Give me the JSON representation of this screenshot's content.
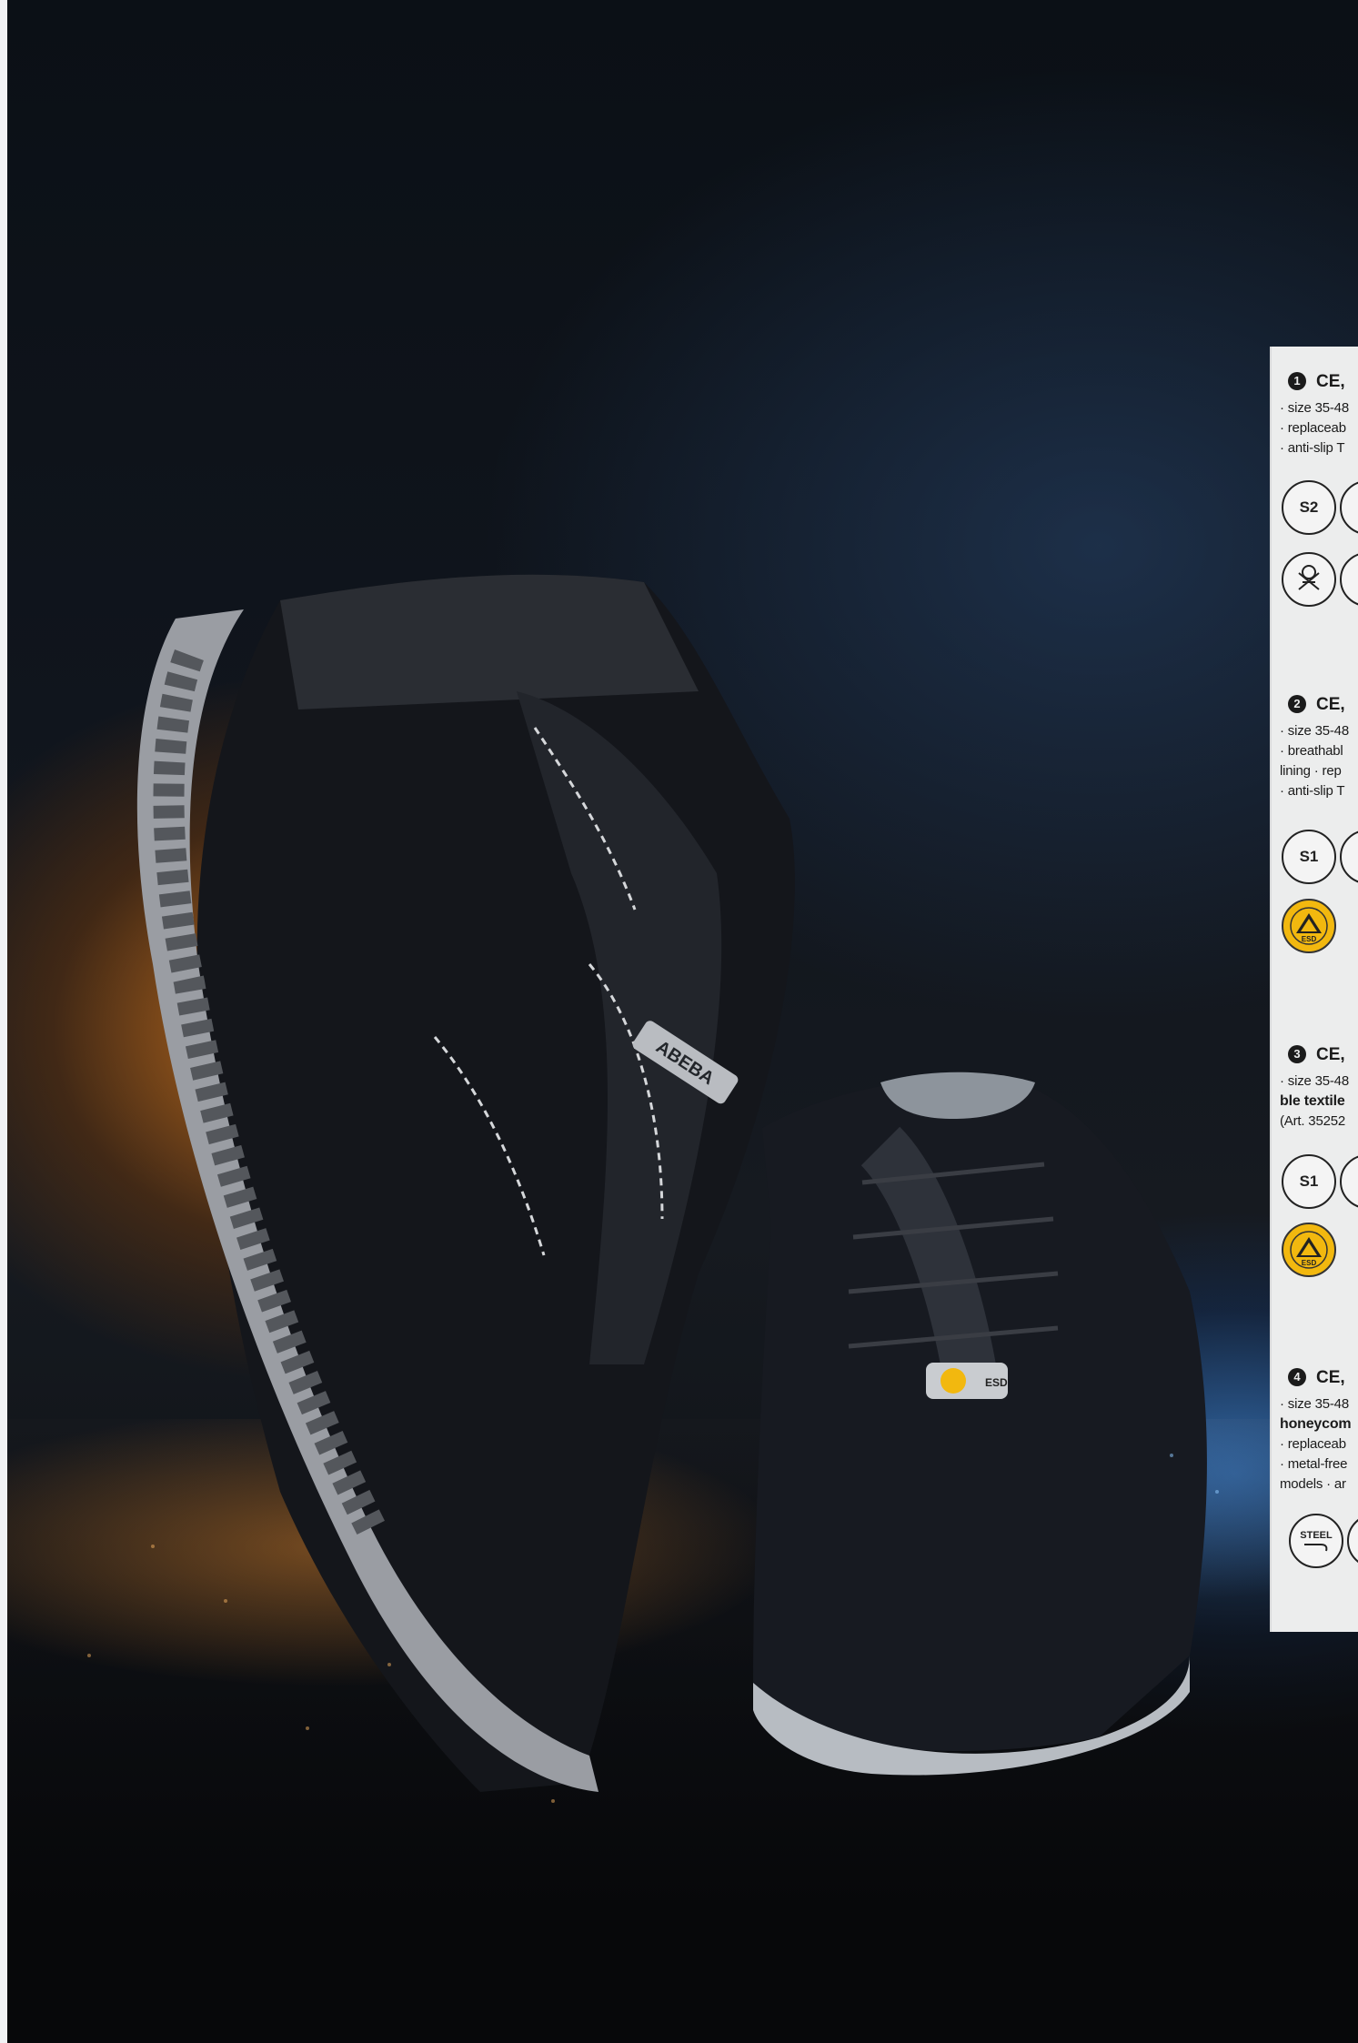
{
  "brand": {
    "logo_text": "ABEBA"
  },
  "heel_badge": "ESD",
  "entries": [
    {
      "number": "1",
      "heading": "CE,",
      "lines": [
        {
          "text": "· size 35-48",
          "bold": false
        },
        {
          "text": "· replaceab",
          "bold": false
        },
        {
          "text": "· anti-slip T",
          "bold": false
        }
      ],
      "badges": [
        "S2",
        "chef-icon"
      ]
    },
    {
      "number": "2",
      "heading": "CE,",
      "lines": [
        {
          "text": "· size 35-48",
          "bold": false
        },
        {
          "text": "· breathabl",
          "bold": false
        },
        {
          "text": "lining · rep",
          "bold": false
        },
        {
          "text": "· anti-slip T",
          "bold": false
        }
      ],
      "badges": [
        "S1",
        "ESD"
      ]
    },
    {
      "number": "3",
      "heading": "CE,",
      "lines": [
        {
          "text": "· size 35-48",
          "bold": false
        },
        {
          "text": "ble textile",
          "bold": true
        },
        {
          "text": "(Art. 35252",
          "bold": false
        }
      ],
      "badges": [
        "S1",
        "ESD"
      ]
    },
    {
      "number": "4",
      "heading": "CE,",
      "lines": [
        {
          "text": "· size 35-48",
          "bold": false
        },
        {
          "text": "honeycom",
          "bold": true
        },
        {
          "text": "· replaceab",
          "bold": false
        },
        {
          "text": "· metal-free",
          "bold": false
        },
        {
          "text": "models · ar",
          "bold": false
        }
      ],
      "badges": [
        "STEEL"
      ]
    }
  ]
}
